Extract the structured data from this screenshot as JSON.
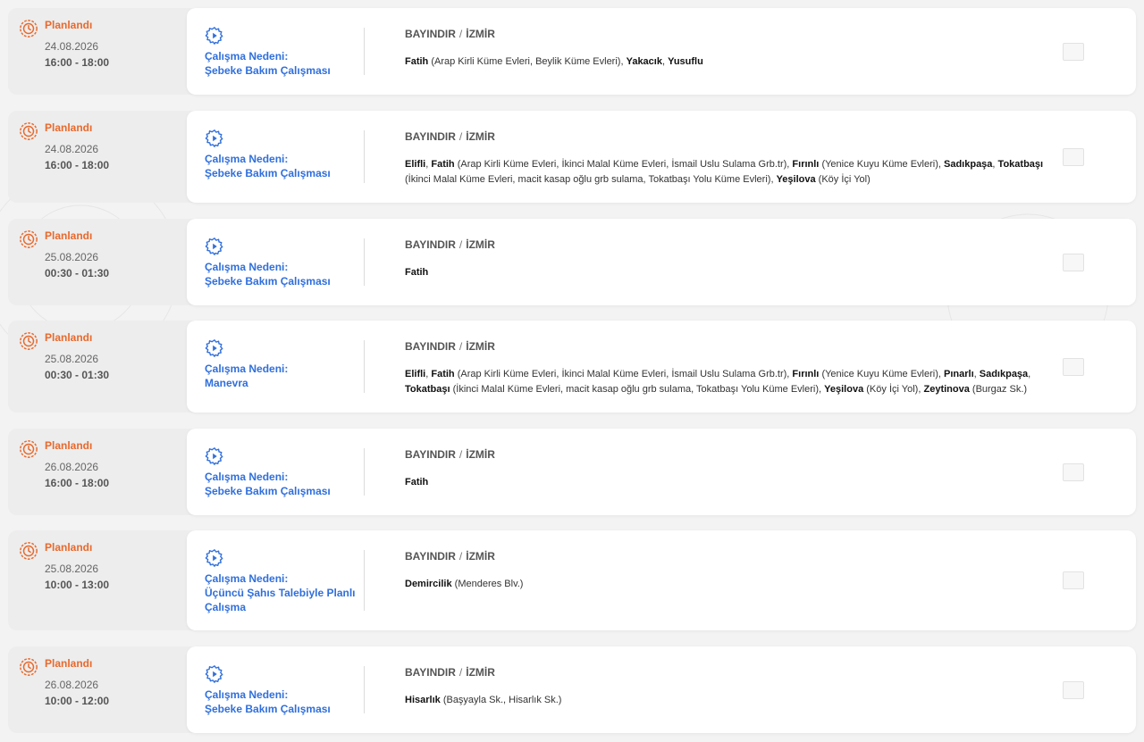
{
  "outages": [
    {
      "status": "Planlandı",
      "date": "24.08.2026",
      "time": "16:00 - 18:00",
      "reason_label": "Çalışma Nedeni:",
      "reason": "Şebeke Bakım Çalışması",
      "district": "BAYINDIR",
      "city": "İZMİR",
      "areas": [
        {
          "name": "Fatih",
          "detail": "(Arap Kirli Küme Evleri, Beylik Küme Evleri)"
        },
        {
          "name": "Yakacık",
          "detail": ""
        },
        {
          "name": "Yusuflu",
          "detail": ""
        }
      ]
    },
    {
      "status": "Planlandı",
      "date": "24.08.2026",
      "time": "16:00 - 18:00",
      "reason_label": "Çalışma Nedeni:",
      "reason": "Şebeke Bakım Çalışması",
      "district": "BAYINDIR",
      "city": "İZMİR",
      "areas": [
        {
          "name": "Elifli",
          "detail": ""
        },
        {
          "name": "Fatih",
          "detail": "(Arap Kirli Küme Evleri, İkinci Malal Küme Evleri, İsmail Uslu Sulama Grb.tr)"
        },
        {
          "name": "Fırınlı",
          "detail": "(Yenice Kuyu Küme Evleri)"
        },
        {
          "name": "Sadıkpaşa",
          "detail": ""
        },
        {
          "name": "Tokatbaşı",
          "detail": "(İkinci Malal Küme Evleri, macit kasap oğlu grb sulama, Tokatbaşı Yolu Küme Evleri)"
        },
        {
          "name": "Yeşilova",
          "detail": "(Köy İçi Yol)"
        }
      ]
    },
    {
      "status": "Planlandı",
      "date": "25.08.2026",
      "time": "00:30 - 01:30",
      "reason_label": "Çalışma Nedeni:",
      "reason": "Şebeke Bakım Çalışması",
      "district": "BAYINDIR",
      "city": "İZMİR",
      "areas": [
        {
          "name": "Fatih",
          "detail": ""
        }
      ]
    },
    {
      "status": "Planlandı",
      "date": "25.08.2026",
      "time": "00:30 - 01:30",
      "reason_label": "Çalışma Nedeni:",
      "reason": "Manevra",
      "district": "BAYINDIR",
      "city": "İZMİR",
      "areas": [
        {
          "name": "Elifli",
          "detail": ""
        },
        {
          "name": "Fatih",
          "detail": "(Arap Kirli Küme Evleri, İkinci Malal Küme Evleri, İsmail Uslu Sulama Grb.tr)"
        },
        {
          "name": "Fırınlı",
          "detail": "(Yenice Kuyu Küme Evleri)"
        },
        {
          "name": "Pınarlı",
          "detail": ""
        },
        {
          "name": "Sadıkpaşa",
          "detail": ""
        },
        {
          "name": "Tokatbaşı",
          "detail": "(İkinci Malal Küme Evleri, macit kasap oğlu grb sulama, Tokatbaşı Yolu Küme Evleri)"
        },
        {
          "name": "Yeşilova",
          "detail": "(Köy İçi Yol)"
        },
        {
          "name": "Zeytinova",
          "detail": "(Burgaz Sk.)"
        }
      ]
    },
    {
      "status": "Planlandı",
      "date": "26.08.2026",
      "time": "16:00 - 18:00",
      "reason_label": "Çalışma Nedeni:",
      "reason": "Şebeke Bakım Çalışması",
      "district": "BAYINDIR",
      "city": "İZMİR",
      "areas": [
        {
          "name": "Fatih",
          "detail": ""
        }
      ]
    },
    {
      "status": "Planlandı",
      "date": "25.08.2026",
      "time": "10:00 - 13:00",
      "reason_label": "Çalışma Nedeni:",
      "reason": "Üçüncü Şahıs Talebiyle Planlı Çalışma",
      "district": "BAYINDIR",
      "city": "İZMİR",
      "areas": [
        {
          "name": "Demircilik",
          "detail": "(Menderes Blv.)"
        }
      ]
    },
    {
      "status": "Planlandı",
      "date": "26.08.2026",
      "time": "10:00 - 12:00",
      "reason_label": "Çalışma Nedeni:",
      "reason": "Şebeke Bakım Çalışması",
      "district": "BAYINDIR",
      "city": "İZMİR",
      "areas": [
        {
          "name": "Hisarlık",
          "detail": "(Başyayla Sk., Hisarlık Sk.)"
        }
      ]
    }
  ],
  "location_separator": "/",
  "icons": {
    "status": "planned-clock-gear-icon",
    "reason": "maintenance-gear-icon",
    "toggle": "expand-toggle"
  },
  "colors": {
    "status": "#e8692c",
    "reason": "#2f6fdc"
  }
}
